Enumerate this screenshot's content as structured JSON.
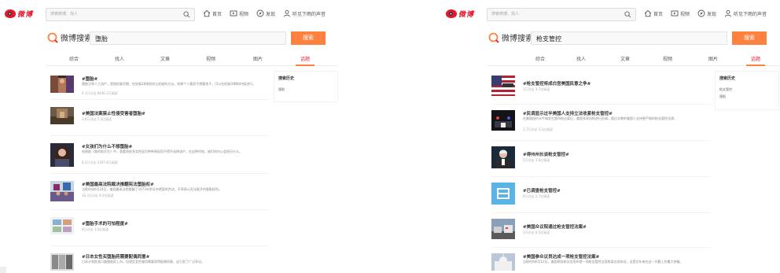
{
  "left": {
    "logo_text": "微博",
    "top_search_placeholder": "搜索微博、找人",
    "nav": [
      "首页",
      "视频",
      "发现",
      "听见下雨的声音"
    ],
    "brand": "微博搜索",
    "query": "堕胎",
    "search_button": "搜索",
    "tabs": [
      "综合",
      "找人",
      "文章",
      "视频",
      "图片",
      "话题"
    ],
    "active_tab": 5,
    "results": [
      {
        "title": "#堕胎#",
        "desc": "堕胎又称人工流产，是指妊娠早期，在妊娠28周前终止妊娠的方法。如果个人意愿不想要孩子，可以在妊娠早期的时候进行。",
        "meta": "9.1万讨论 6446.3万阅读"
      },
      {
        "title": "#美国法案禁止性侵受害者堕胎#",
        "desc": "",
        "meta": "3.6万讨论 2.3亿阅读"
      },
      {
        "title": "#女孩们为什么不想堕胎#",
        "desc": "电视剧《我的前半生》中，我看到很多女性因为种种原因而不得不选择流产。在这种时刻，她们的内心会经历什么。",
        "meta": "8.2万讨论 3307.8万阅读"
      },
      {
        "title": "#美国最高法院裁决推翻宪法堕胎权#",
        "desc": "当地时间6月24日，美国最高法院推翻了1973年罗诉韦德案的判决，不再承认宪法赋予的堕胎权利。",
        "meta": "16.3万讨论 9.2亿阅读"
      },
      {
        "title": "#堕胎手术的可怕程度#",
        "desc": "",
        "meta": "8万讨论 1.2亿阅读"
      },
      {
        "title": "#日本女性买堕胎药需要配偶同意#",
        "desc": "日本计划批准口服堕胎药上市，但规定女性服用需要获得配偶同意，这引发了广泛争议。",
        "meta": ""
      }
    ],
    "history_title": "搜索历史",
    "history": [
      "堕胎"
    ]
  },
  "right": {
    "logo_text": "微博",
    "top_search_placeholder": "搜索微博、找人",
    "nav": [
      "首页",
      "视频",
      "发现",
      "听见下雨的声音"
    ],
    "brand": "微博搜索",
    "query": "枪支管控",
    "search_button": "搜索",
    "tabs": [
      "综合",
      "找人",
      "文章",
      "视频",
      "图片",
      "话题"
    ],
    "active_tab": 5,
    "results": [
      {
        "title": "#枪支管控将成白宫美国民意之争#",
        "desc": "",
        "meta": "3万讨论 3.7亿阅读"
      },
      {
        "title": "#民调显示过半美国人支持立法收紧枪支管控#",
        "desc": "在美国纽约水牛城发生超市枪击案后，美国多家机构进行民调，超过半数的美国人支持更严格的枪支管控法律。",
        "meta": "2.7万讨论 3.1亿阅读"
      },
      {
        "title": "#得州州长谈枪支管控#",
        "desc": "",
        "meta": "5万讨论 1.6亿阅读"
      },
      {
        "title": "#已调查枪支管控#",
        "desc": "",
        "meta": "8万讨论 2.7亿阅读"
      },
      {
        "title": "#美国众议院通过枪支管控法案#",
        "desc": "",
        "meta": "1万讨论 9.2亿阅读"
      },
      {
        "title": "#美国参众议员达成一项枪支管控法案#",
        "desc": "当地时间6月12日，美国两党参议员宣布就一项枪支管控法案框架达成协议，这是近年来在这一问题上的重大突破。",
        "meta": ""
      }
    ],
    "history_title": "搜索历史",
    "history": [
      "枪支管控",
      "堕胎"
    ]
  }
}
